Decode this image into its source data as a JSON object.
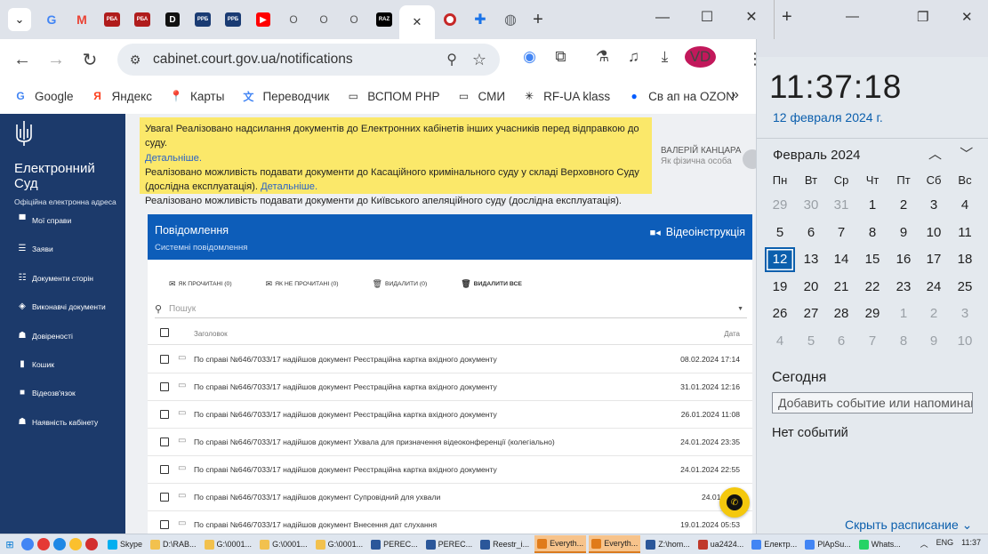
{
  "browser": {
    "tabs": [
      {
        "icon": "G",
        "color": "#4285f4",
        "name": "google-tab"
      },
      {
        "icon": "M",
        "color": "#ea4335",
        "name": "gmail-tab"
      },
      {
        "icon": "РБА",
        "color": "#b01c1c",
        "name": "rba-tab-1"
      },
      {
        "icon": "РБА",
        "color": "#b01c1c",
        "name": "rba-tab-2"
      },
      {
        "icon": "D",
        "color": "#111111",
        "name": "d-tab"
      },
      {
        "icon": "РРБ",
        "color": "#1a3b73",
        "name": "rrb-tab-1"
      },
      {
        "icon": "РРБ",
        "color": "#1a3b73",
        "name": "rrb-tab-2"
      },
      {
        "icon": "▶",
        "color": "#ff0000",
        "name": "youtube-tab"
      },
      {
        "icon": "О",
        "color": "#6b6b6b",
        "name": "o-tab-1",
        "label": "О"
      },
      {
        "icon": "О",
        "color": "#6b6b6b",
        "name": "o-tab-2",
        "label": "О"
      },
      {
        "icon": "О",
        "color": "#6b6b6b",
        "name": "o-tab-3",
        "label": "О"
      },
      {
        "icon": "RAZ",
        "color": "#000000",
        "name": "raz-tab"
      }
    ],
    "active_tab_close": "✕",
    "url": "cabinet.court.gov.ua/notifications",
    "profile_initials": "VD",
    "bookmarks": [
      {
        "label": "Google",
        "icon": "G",
        "color": "#4285f4"
      },
      {
        "label": "Яндекс",
        "icon": "Я",
        "color": "#fc3f1d"
      },
      {
        "label": "Карты",
        "icon": "📍",
        "color": "#34a853"
      },
      {
        "label": "Переводчик",
        "icon": "文",
        "color": "#4285f4"
      },
      {
        "label": "ВСПОМ РНР",
        "icon": "▭",
        "color": "#333333"
      },
      {
        "label": "СМИ",
        "icon": "▭",
        "color": "#333333"
      },
      {
        "label": "RF-UA klass",
        "icon": "✳",
        "color": "#111111"
      },
      {
        "label": "Св ап на OZON",
        "icon": "●",
        "color": "#005bff"
      }
    ]
  },
  "sidebar": {
    "brand_line1": "Електронний",
    "brand_line2": "Суд",
    "brand_sub": "Офіційна електронна адреса",
    "items": [
      {
        "label": "Мої справи",
        "icon": "▀",
        "name": "sidebar-item-my-cases"
      },
      {
        "label": "Заяви",
        "icon": "☰",
        "name": "sidebar-item-applications"
      },
      {
        "label": "Документи сторін",
        "icon": "☷",
        "name": "sidebar-item-party-documents"
      },
      {
        "label": "Виконавчі документи",
        "icon": "◈",
        "name": "sidebar-item-enforcement-documents"
      },
      {
        "label": "Довіреності",
        "icon": "☗",
        "name": "sidebar-item-powers-of-attorney"
      },
      {
        "label": "Кошик",
        "icon": "▮",
        "name": "sidebar-item-trash"
      },
      {
        "label": "Відеозв'язок",
        "icon": "■",
        "name": "sidebar-item-video"
      },
      {
        "label": "Наявність кабінету",
        "icon": "☗",
        "name": "sidebar-item-cabinet-availability"
      }
    ]
  },
  "notice": {
    "line1": "Увага! Реалізовано надсилання документів до Електронних кабінетів інших учасників перед відправкою до суду.",
    "link1": "Детальніше.",
    "line2": "Реалізовано можливість подавати документи до Касаційного кримінального суду у складі Верховного Суду",
    "line3": "(дослідна експлуатація).",
    "link2": "Детальніше.",
    "line4": "Реалізовано можливість подавати документи до Київського апеляційного суду (дослідна експлуатація)."
  },
  "user": {
    "name": "ВАЛЕРІЙ КАНЦАРА",
    "role": "Як фізична особа"
  },
  "card": {
    "title": "Повідомлення",
    "subtitle": "Системні повідомлення",
    "video_label": "Відеоінструкція",
    "actions": [
      {
        "label": "ЯК ПРОЧИТАНІ (0)",
        "icon": "✉",
        "bold": false
      },
      {
        "label": "ЯК НЕ ПРОЧИТАНІ (0)",
        "icon": "✉",
        "bold": false
      },
      {
        "label": "ВИДАЛИТИ (0)",
        "icon": "🗑",
        "bold": false
      },
      {
        "label": "ВИДАЛИТИ ВСЕ",
        "icon": "🗑",
        "bold": true
      }
    ],
    "search_placeholder": "Пошук",
    "col_title": "Заголовок",
    "col_date": "Дата",
    "rows": [
      {
        "msg": "По справі №646/7033/17 надійшов документ Реєстраційна картка вхідного документу",
        "date": "08.02.2024 17:14"
      },
      {
        "msg": "По справі №646/7033/17 надійшов документ Реєстраційна картка вхідного документу",
        "date": "31.01.2024 12:16"
      },
      {
        "msg": "По справі №646/7033/17 надійшов документ Реєстраційна картка вхідного документу",
        "date": "26.01.2024 11:08"
      },
      {
        "msg": "По справі №646/7033/17 надійшов документ Ухвала для призначення відеоконференції (колегіально)",
        "date": "24.01.2024 23:35"
      },
      {
        "msg": "По справі №646/7033/17 надійшов документ Реєстраційна картка вхідного документу",
        "date": "24.01.2024 22:55"
      },
      {
        "msg": "По справі №646/7033/17 надійшов документ Супровідний для ухвали",
        "date": "24.01.2024"
      },
      {
        "msg": "По справі №646/7033/17 надійшов документ Внесення дат слухання",
        "date": "19.01.2024 05:53"
      }
    ]
  },
  "calendar": {
    "time": "11:37:18",
    "date": "12 февраля 2024 г.",
    "month": "Февраль 2024",
    "weekdays": [
      "Пн",
      "Вт",
      "Ср",
      "Чт",
      "Пт",
      "Сб",
      "Вс"
    ],
    "weeks": [
      [
        {
          "d": "29",
          "dim": true
        },
        {
          "d": "30",
          "dim": true
        },
        {
          "d": "31",
          "dim": true
        },
        {
          "d": "1"
        },
        {
          "d": "2"
        },
        {
          "d": "3"
        },
        {
          "d": "4"
        }
      ],
      [
        {
          "d": "5"
        },
        {
          "d": "6"
        },
        {
          "d": "7"
        },
        {
          "d": "8"
        },
        {
          "d": "9"
        },
        {
          "d": "10"
        },
        {
          "d": "11"
        }
      ],
      [
        {
          "d": "12",
          "today": true
        },
        {
          "d": "13"
        },
        {
          "d": "14"
        },
        {
          "d": "15"
        },
        {
          "d": "16"
        },
        {
          "d": "17"
        },
        {
          "d": "18"
        }
      ],
      [
        {
          "d": "19"
        },
        {
          "d": "20"
        },
        {
          "d": "21"
        },
        {
          "d": "22"
        },
        {
          "d": "23"
        },
        {
          "d": "24"
        },
        {
          "d": "25"
        }
      ],
      [
        {
          "d": "26"
        },
        {
          "d": "27"
        },
        {
          "d": "28"
        },
        {
          "d": "29"
        },
        {
          "d": "1",
          "dim": true
        },
        {
          "d": "2",
          "dim": true
        },
        {
          "d": "3",
          "dim": true
        }
      ],
      [
        {
          "d": "4",
          "dim": true
        },
        {
          "d": "5",
          "dim": true
        },
        {
          "d": "6",
          "dim": true
        },
        {
          "d": "7",
          "dim": true
        },
        {
          "d": "8",
          "dim": true
        },
        {
          "d": "9",
          "dim": true
        },
        {
          "d": "10",
          "dim": true
        }
      ]
    ],
    "today_heading": "Сегодня",
    "add_event_placeholder": "Добавить событие или напоминание",
    "no_events": "Нет событий",
    "hide_schedule": "Скрыть расписание"
  },
  "taskbar": {
    "items": [
      {
        "label": "Skype",
        "color": "#00aff0",
        "active": false
      },
      {
        "label": "D:\\RAB...",
        "color": "#f2c14e",
        "active": false
      },
      {
        "label": "G:\\0001...",
        "color": "#f2c14e",
        "active": false
      },
      {
        "label": "G:\\0001...",
        "color": "#f2c14e",
        "active": false
      },
      {
        "label": "G:\\0001...",
        "color": "#f2c14e",
        "active": false
      },
      {
        "label": "PERЕС...",
        "color": "#2b579a",
        "active": false
      },
      {
        "label": "PERЕС...",
        "color": "#2b579a",
        "active": false
      },
      {
        "label": "Reestr_i...",
        "color": "#2b579a",
        "active": false
      },
      {
        "label": "Everyth...",
        "color": "#e07b1a",
        "active": true
      },
      {
        "label": "Everyth...",
        "color": "#e07b1a",
        "active": true
      },
      {
        "label": "Z:\\hom...",
        "color": "#2b579a",
        "active": false
      },
      {
        "label": "ua2424...",
        "color": "#c0392b",
        "active": false
      },
      {
        "label": "Електр...",
        "color": "#4285f4",
        "active": false
      },
      {
        "label": "PlApSu...",
        "color": "#4285f4",
        "active": false
      },
      {
        "label": "Whats...",
        "color": "#25d366",
        "active": false
      }
    ],
    "lang": "ENG",
    "time": "11:37"
  }
}
